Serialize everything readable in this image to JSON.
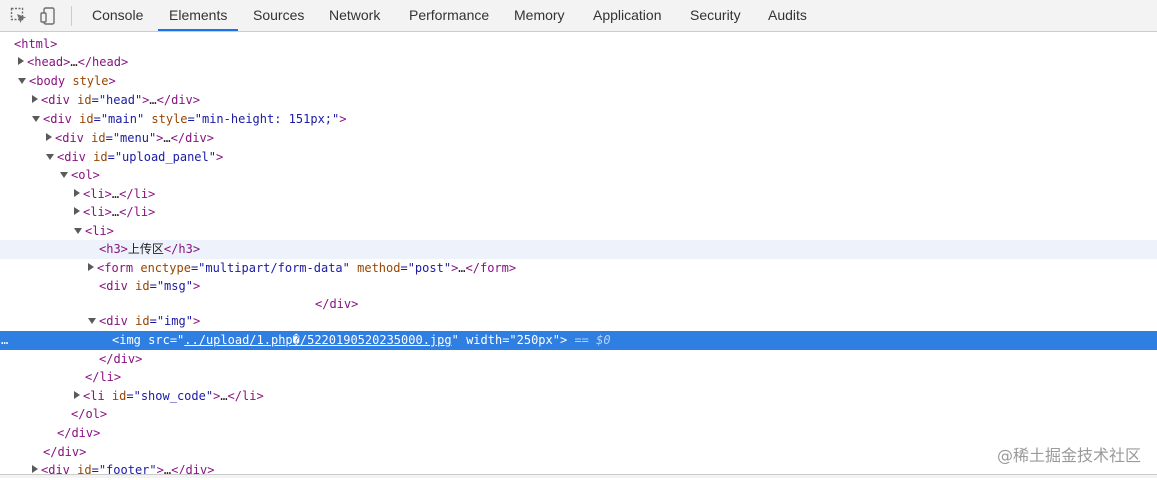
{
  "toolbar": {
    "icons": [
      "inspect-element-icon",
      "device-toggle-icon"
    ],
    "tabs": [
      {
        "label": "Console"
      },
      {
        "label": "Elements",
        "active": true
      },
      {
        "label": "Sources"
      },
      {
        "label": "Network"
      },
      {
        "label": "Performance"
      },
      {
        "label": "Memory"
      },
      {
        "label": "Application"
      },
      {
        "label": "Security"
      },
      {
        "label": "Audits"
      }
    ]
  },
  "dom_tree": {
    "html": "<html>",
    "head": [
      "<head>",
      "…",
      "</head>"
    ],
    "body": [
      "<body",
      "style",
      ">"
    ],
    "div_head": [
      "<div",
      "id",
      "=\"head\"",
      ">",
      "…",
      "</div>"
    ],
    "div_main": [
      "<div",
      "id",
      "=\"main\"",
      "style",
      "=\"min-height: 151px;\"",
      ">"
    ],
    "div_menu": [
      "<div",
      "id",
      "=\"menu\"",
      ">",
      "…",
      "</div>"
    ],
    "div_upload": [
      "<div",
      "id",
      "=\"upload_panel\"",
      ">"
    ],
    "ol_open": "<ol>",
    "li_collapsed": [
      "<li>",
      "…",
      "</li>"
    ],
    "li_open": "<li>",
    "h3": [
      "<h3>",
      "上传区",
      "</h3>"
    ],
    "form": [
      "<form",
      "enctype",
      "=\"multipart/form-data\"",
      "method",
      "=\"post\"",
      ">",
      "…",
      "</form>"
    ],
    "div_msg": [
      "<div",
      "id",
      "=\"msg\"",
      ">"
    ],
    "div_close": "</div>",
    "div_img": [
      "<div",
      "id",
      "=\"img\"",
      ">"
    ],
    "img": [
      "<img",
      "src",
      "=\"",
      "../upload/1.php�/5220190520235000.jpg",
      "\"",
      "width",
      "=\"250px\"",
      ">",
      "== $0"
    ],
    "ellipsis": "…",
    "li_close": "</li>",
    "li_show_code": [
      "<li",
      "id",
      "=\"show_code\"",
      ">",
      "…",
      "</li>"
    ],
    "ol_close": "</ol>",
    "body_close": "</div>",
    "main_close": "</div>",
    "div_footer": [
      "<div",
      "id",
      "=\"footer\"",
      ">",
      "…",
      "</div>"
    ]
  },
  "watermark": "@稀土掘金技术社区"
}
